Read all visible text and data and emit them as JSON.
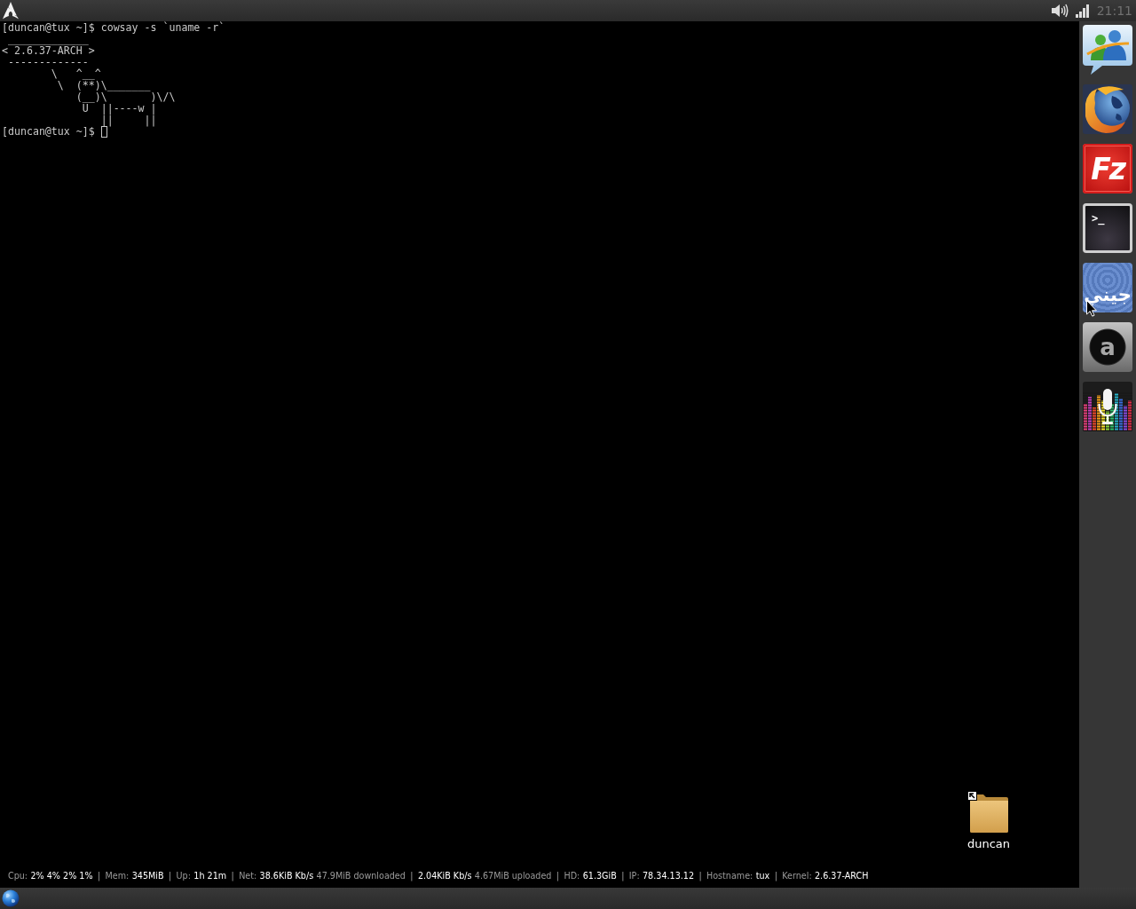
{
  "top_bar": {
    "clock": "21:11"
  },
  "terminal": {
    "lines": [
      {
        "kind": "command",
        "prompt": "[duncan@tux ~]$",
        "text": "cowsay -s `uname -r`"
      },
      {
        "kind": "output",
        "text": " _____________"
      },
      {
        "kind": "output",
        "text": "< 2.6.37-ARCH >"
      },
      {
        "kind": "output",
        "text": " -------------"
      },
      {
        "kind": "output",
        "text": "        \\   ^__^"
      },
      {
        "kind": "output",
        "text": "         \\  (**)\\_______"
      },
      {
        "kind": "output",
        "text": "            (__)\\       )\\/\\"
      },
      {
        "kind": "output",
        "text": "             U  ||----w |"
      },
      {
        "kind": "output",
        "text": "                ||     ||"
      },
      {
        "kind": "input",
        "prompt": "[duncan@tux ~]$"
      }
    ]
  },
  "desktop_icons": [
    {
      "kind": "folder",
      "label": "duncan",
      "shortcut": true
    }
  ],
  "status_line": [
    {
      "kind": "label",
      "text": "Cpu:"
    },
    {
      "kind": "value",
      "text": "2% 4% 2% 1%"
    },
    {
      "kind": "separator",
      "text": "|"
    },
    {
      "kind": "label",
      "text": "Mem:"
    },
    {
      "kind": "value",
      "text": "345MiB"
    },
    {
      "kind": "separator",
      "text": "|"
    },
    {
      "kind": "label",
      "text": "Up:"
    },
    {
      "kind": "value",
      "text": "1h 21m"
    },
    {
      "kind": "separator",
      "text": "|"
    },
    {
      "kind": "label",
      "text": "Net:"
    },
    {
      "kind": "value",
      "text": "38.6KiB Kb/s"
    },
    {
      "kind": "label",
      "text": "47.9MiB downloaded"
    },
    {
      "kind": "separator",
      "text": "|"
    },
    {
      "kind": "value",
      "text": "2.04KiB Kb/s"
    },
    {
      "kind": "label",
      "text": "4.67MiB uploaded"
    },
    {
      "kind": "separator",
      "text": "|"
    },
    {
      "kind": "label",
      "text": "HD:"
    },
    {
      "kind": "value",
      "text": "61.3GiB"
    },
    {
      "kind": "separator",
      "text": "|"
    },
    {
      "kind": "label",
      "text": "IP:"
    },
    {
      "kind": "value",
      "text": "78.34.13.12"
    },
    {
      "kind": "separator",
      "text": "|"
    },
    {
      "kind": "label",
      "text": "Hostname:"
    },
    {
      "kind": "value",
      "text": "tux"
    },
    {
      "kind": "separator",
      "text": "|"
    },
    {
      "kind": "label",
      "text": "Kernel:"
    },
    {
      "kind": "value",
      "text": "2.6.37-ARCH"
    }
  ],
  "dock": [
    {
      "kind": "chat"
    },
    {
      "kind": "browser"
    },
    {
      "kind": "stamp",
      "glyph": "Fz"
    },
    {
      "kind": "console",
      "glyph": ">_"
    },
    {
      "kind": "script",
      "glyph": "جيني"
    },
    {
      "kind": "disc",
      "glyph": "a"
    },
    {
      "kind": "mic"
    }
  ]
}
